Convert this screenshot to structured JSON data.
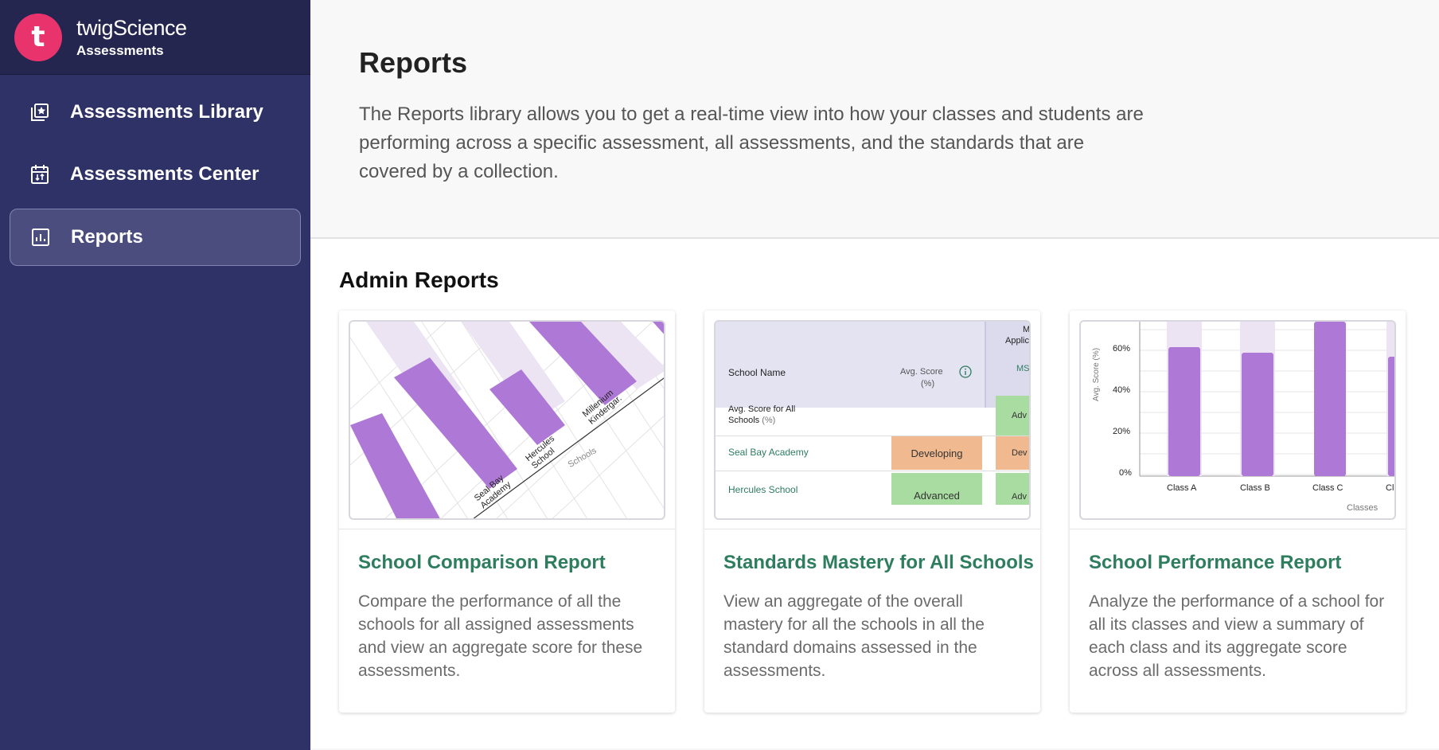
{
  "brand": {
    "logo_letter": "t",
    "name_prefix": "twig",
    "name_suffix": "Science",
    "subtitle": "Assessments"
  },
  "sidebar": {
    "items": [
      {
        "label": "Assessments Library",
        "icon": "library-icon",
        "active": false
      },
      {
        "label": "Assessments Center",
        "icon": "calendar-icon",
        "active": false
      },
      {
        "label": "Reports",
        "icon": "report-icon",
        "active": true
      }
    ]
  },
  "header": {
    "title": "Reports",
    "description": "The Reports library allows you to get a real-time view into how your classes and students are performing across a specific assessment, all assessments, and the standards that are covered by a collection."
  },
  "section": {
    "title": "Admin Reports"
  },
  "cards": [
    {
      "title": "School Comparison Report",
      "description": "Compare the performance of all the schools for all assigned assessments and view an aggregate score for these assessments.",
      "preview": {
        "labels": [
          "Seal Bay Academy",
          "Hercules School",
          "Millenium Kindergar."
        ],
        "axis_label": "Schools"
      }
    },
    {
      "title": "Standards Mastery for All Schools",
      "description": "View an aggregate of the overall mastery for all the schools in all the standard domains assessed in the assessments.",
      "preview": {
        "col_school": "School Name",
        "col_avg": "Avg. Score",
        "col_avg_unit": "(%)",
        "col_extra_top": "M",
        "col_extra_sub": "Applic",
        "col_extra_code": "MS",
        "row_all": "Avg. Score for All",
        "row_all_2": "Schools",
        "row_all_unit": "(%)",
        "row_all_badge": "Adv",
        "rows": [
          {
            "school": "Seal Bay Academy",
            "level": "Developing",
            "extra": "Dev"
          },
          {
            "school": "Hercules School",
            "level": "Advanced",
            "extra": "Adv"
          }
        ]
      }
    },
    {
      "title": "School Performance Report",
      "description": "Analyze the performance of a school for all its classes and view a summary of each class and its aggregate score across all assessments.",
      "preview": {
        "ylabel": "Avg. Score (%)",
        "xlabel": "Classes",
        "yticks": [
          "60%",
          "40%",
          "20%",
          "0%"
        ],
        "classes": [
          "Class A",
          "Class B",
          "Class C",
          "Cl"
        ],
        "colors": {
          "bar": "#ae78d6",
          "bg_bar": "#ece3f3"
        }
      }
    }
  ]
}
